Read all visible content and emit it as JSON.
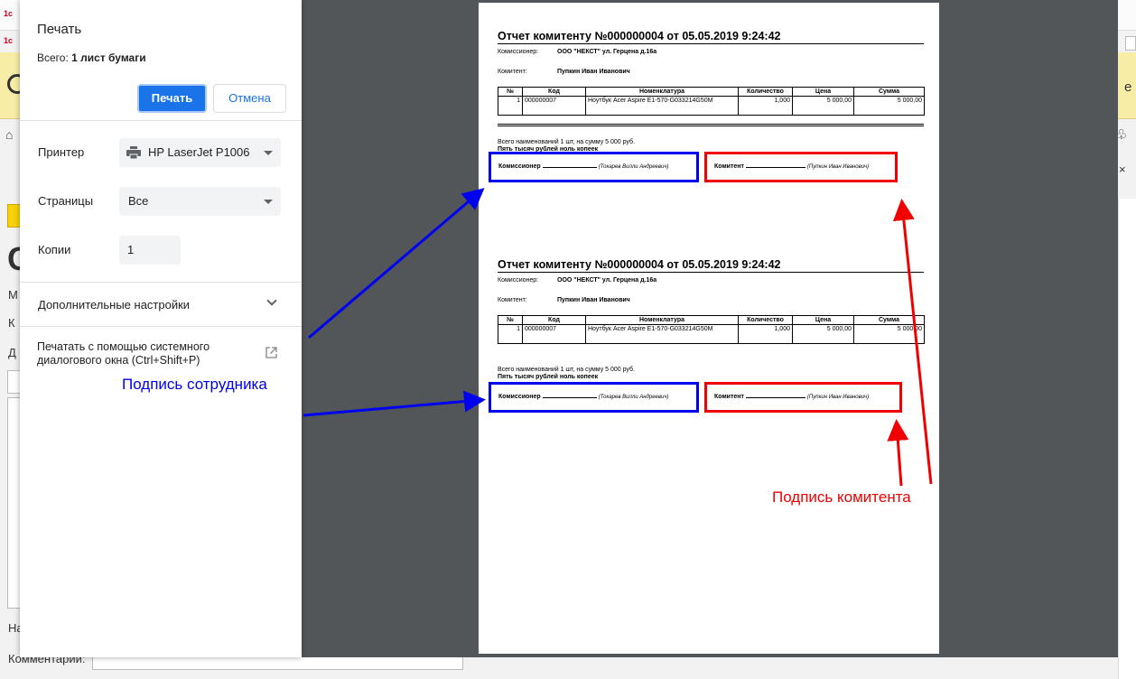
{
  "background": {
    "logo": "1с",
    "right_letter": "е",
    "label_m": "М",
    "label_k": "К",
    "label_d": "Д",
    "label_na": "На",
    "comment_label": "Комментарий:"
  },
  "dialog": {
    "title": "Печать",
    "total_prefix": "Всего:",
    "total_value": "1 лист бумаги",
    "print_button": "Печать",
    "cancel_button": "Отмена",
    "printer_label": "Принтер",
    "printer_value": "HP LaserJet P1006",
    "pages_label": "Страницы",
    "pages_value": "Все",
    "copies_label": "Копии",
    "copies_value": "1",
    "more_settings": "Дополнительные настройки",
    "system_dialog": "Печатать с помощью системного диалогового окна (Ctrl+Shift+P)"
  },
  "document": {
    "title": "Отчет комитенту  №000000004 от 05.05.2019 9:24:42",
    "commissioner_label": "Комиссионер:",
    "commissioner_value": "ООО \"НЕКСТ\" ул. Герцена д.16а",
    "committent_label": "Комитент:",
    "committent_value": "Пупкин Иван Иванович",
    "columns": [
      "№",
      "Код",
      "Номенклатура",
      "Количество",
      "Цена",
      "Сумма"
    ],
    "rows": [
      {
        "num": "1",
        "code": "000000007",
        "name": "Ноутбук Acer Aspire E1-570-G033214G50M",
        "qty": "1,000",
        "price": "5 000,00",
        "sum": "5 000,00"
      }
    ],
    "total_text": "Всего наименований 1 шт, на сумму 5 000 руб.",
    "total_words": "Пять тысяч рублей ноль копеек",
    "sig_commissioner": "Комиссионер",
    "sig_commissioner_name": "(Токарев Вилли Андреевич)",
    "sig_committent": "Комитент",
    "sig_committent_name": "(Пупкин Иван Иванович)"
  },
  "annotations": {
    "employee_signature": "Подпись сотрудника",
    "committent_signature": "Подпись комитента",
    "employee_color": "#0000f0",
    "committent_color": "#f00000"
  }
}
